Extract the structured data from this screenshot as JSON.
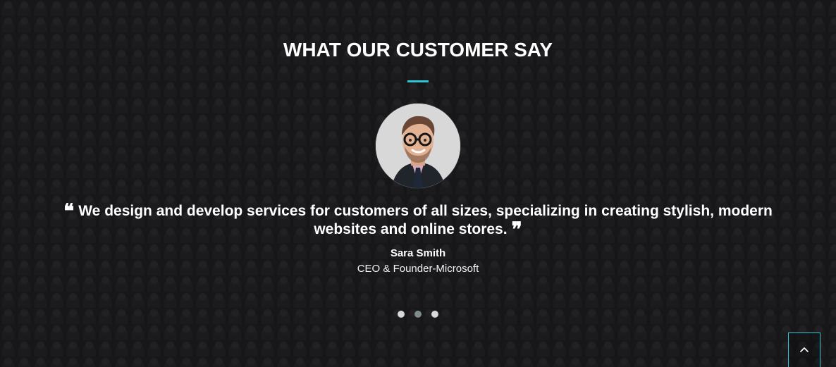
{
  "section": {
    "title": "WHAT OUR CUSTOMER SAY"
  },
  "testimonial": {
    "quote": "We design and develop services for customers of all sizes, specializing in creating stylish, modern websites and online stores.",
    "name": "Sara Smith",
    "role": "CEO & Founder-Microsoft"
  },
  "slider": {
    "dots": 3,
    "active_index": 1
  },
  "colors": {
    "accent": "#2ec5d7",
    "text": "#ffffff",
    "background": "#1d1e20"
  },
  "icons": {
    "quote_open": "quote-open-icon",
    "quote_close": "quote-close-icon",
    "scroll_top": "chevron-up-icon"
  }
}
